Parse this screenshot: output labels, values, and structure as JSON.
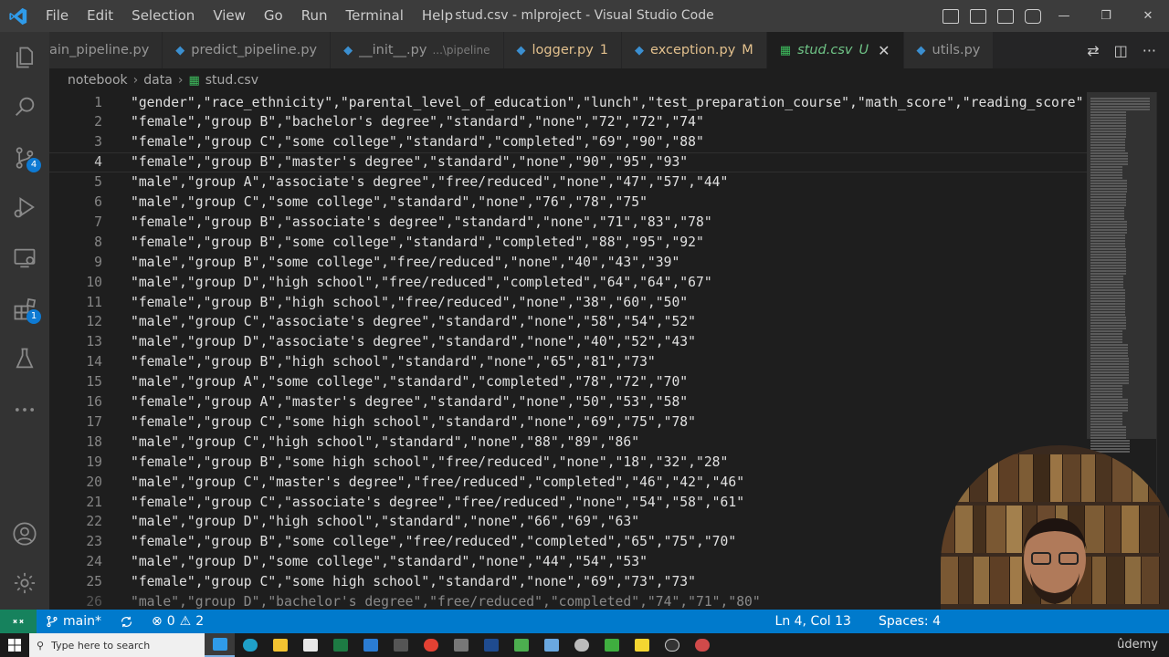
{
  "window": {
    "title": "stud.csv - mlproject - Visual Studio Code",
    "menu": [
      "File",
      "Edit",
      "Selection",
      "View",
      "Go",
      "Run",
      "Terminal",
      "Help"
    ]
  },
  "activity_bar": {
    "items": [
      {
        "icon": "explorer-icon"
      },
      {
        "icon": "search-icon"
      },
      {
        "icon": "source-control-icon",
        "badge": "4"
      },
      {
        "icon": "run-debug-icon"
      },
      {
        "icon": "remote-explorer-icon"
      },
      {
        "icon": "extensions-icon",
        "badge": "1"
      },
      {
        "icon": "testing-icon"
      },
      {
        "icon": "more-icon"
      }
    ],
    "bottom": [
      {
        "icon": "account-icon"
      },
      {
        "icon": "manage-gear-icon"
      }
    ]
  },
  "tabs": [
    {
      "label": "ain_pipeline.py",
      "icon": "python-file-icon",
      "state": "normal"
    },
    {
      "label": "predict_pipeline.py",
      "icon": "python-file-icon",
      "state": "normal"
    },
    {
      "label": "__init__.py",
      "desc": "...\\pipeline",
      "icon": "python-file-icon",
      "state": "normal"
    },
    {
      "label": "logger.py",
      "mark": "1",
      "icon": "python-file-icon",
      "state": "modified"
    },
    {
      "label": "exception.py",
      "mark": "M",
      "icon": "python-file-icon",
      "state": "modified"
    },
    {
      "label": "stud.csv",
      "mark": "U",
      "icon": "csv-file-icon",
      "state": "active"
    },
    {
      "label": "utils.py",
      "icon": "python-file-icon",
      "state": "normal"
    }
  ],
  "breadcrumb": [
    "notebook",
    "data",
    "stud.csv"
  ],
  "editor": {
    "current_line": 4,
    "lines": [
      "\"gender\",\"race_ethnicity\",\"parental_level_of_education\",\"lunch\",\"test_preparation_course\",\"math_score\",\"reading_score\"",
      "\"female\",\"group B\",\"bachelor's degree\",\"standard\",\"none\",\"72\",\"72\",\"74\"",
      "\"female\",\"group C\",\"some college\",\"standard\",\"completed\",\"69\",\"90\",\"88\"",
      "\"female\",\"group B\",\"master's degree\",\"standard\",\"none\",\"90\",\"95\",\"93\"",
      "\"male\",\"group A\",\"associate's degree\",\"free/reduced\",\"none\",\"47\",\"57\",\"44\"",
      "\"male\",\"group C\",\"some college\",\"standard\",\"none\",\"76\",\"78\",\"75\"",
      "\"female\",\"group B\",\"associate's degree\",\"standard\",\"none\",\"71\",\"83\",\"78\"",
      "\"female\",\"group B\",\"some college\",\"standard\",\"completed\",\"88\",\"95\",\"92\"",
      "\"male\",\"group B\",\"some college\",\"free/reduced\",\"none\",\"40\",\"43\",\"39\"",
      "\"male\",\"group D\",\"high school\",\"free/reduced\",\"completed\",\"64\",\"64\",\"67\"",
      "\"female\",\"group B\",\"high school\",\"free/reduced\",\"none\",\"38\",\"60\",\"50\"",
      "\"male\",\"group C\",\"associate's degree\",\"standard\",\"none\",\"58\",\"54\",\"52\"",
      "\"male\",\"group D\",\"associate's degree\",\"standard\",\"none\",\"40\",\"52\",\"43\"",
      "\"female\",\"group B\",\"high school\",\"standard\",\"none\",\"65\",\"81\",\"73\"",
      "\"male\",\"group A\",\"some college\",\"standard\",\"completed\",\"78\",\"72\",\"70\"",
      "\"female\",\"group A\",\"master's degree\",\"standard\",\"none\",\"50\",\"53\",\"58\"",
      "\"female\",\"group C\",\"some high school\",\"standard\",\"none\",\"69\",\"75\",\"78\"",
      "\"male\",\"group C\",\"high school\",\"standard\",\"none\",\"88\",\"89\",\"86\"",
      "\"female\",\"group B\",\"some high school\",\"free/reduced\",\"none\",\"18\",\"32\",\"28\"",
      "\"male\",\"group C\",\"master's degree\",\"free/reduced\",\"completed\",\"46\",\"42\",\"46\"",
      "\"female\",\"group C\",\"associate's degree\",\"free/reduced\",\"none\",\"54\",\"58\",\"61\"",
      "\"male\",\"group D\",\"high school\",\"standard\",\"none\",\"66\",\"69\",\"63\"",
      "\"female\",\"group B\",\"some college\",\"free/reduced\",\"completed\",\"65\",\"75\",\"70\"",
      "\"male\",\"group D\",\"some college\",\"standard\",\"none\",\"44\",\"54\",\"53\"",
      "\"female\",\"group C\",\"some high school\",\"standard\",\"none\",\"69\",\"73\",\"73\"",
      "\"male\",\"group D\",\"bachelor's degree\",\"free/reduced\",\"completed\",\"74\",\"71\",\"80\""
    ]
  },
  "status_bar": {
    "branch": "main*",
    "errors": "0",
    "warnings": "2",
    "cursor": "Ln 4, Col 13",
    "indent": "Spaces: 4"
  },
  "taskbar": {
    "search_placeholder": "Type here to search",
    "watermark": "ûdemy"
  },
  "colors": {
    "accent": "#007acc",
    "remote": "#16825d",
    "titlebar": "#3c3c3c",
    "editor_bg": "#1e1e1e"
  }
}
